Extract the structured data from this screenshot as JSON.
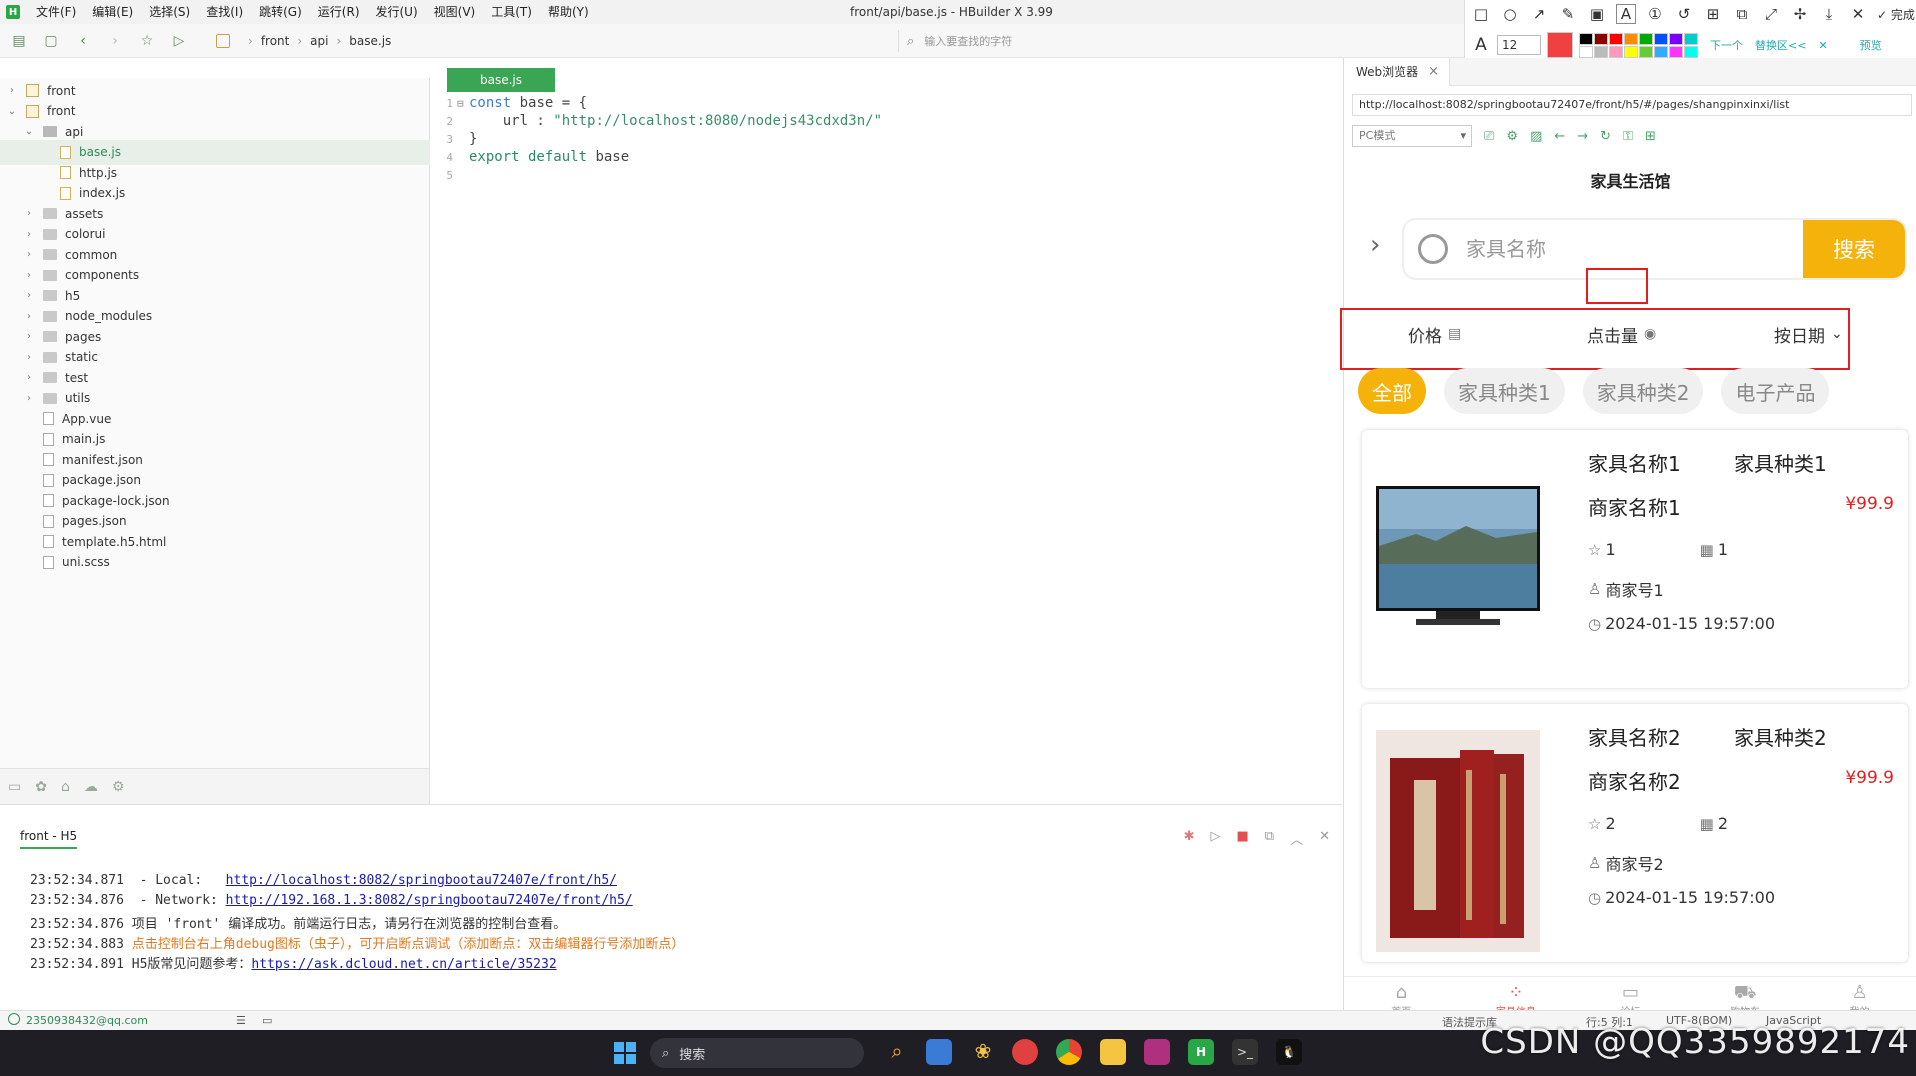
{
  "window": {
    "title": "front/api/base.js - HBuilder X 3.99",
    "menu": [
      "文件(F)",
      "编辑(E)",
      "选择(S)",
      "查找(I)",
      "跳转(G)",
      "运行(R)",
      "发行(U)",
      "视图(V)",
      "工具(T)",
      "帮助(Y)"
    ]
  },
  "screenshot_tool": {
    "done_label": "完成",
    "font_size": "12",
    "link_next": "下一个",
    "link_replace": "替换区<<",
    "preview_label": "预览",
    "palette": [
      "#000000",
      "#8b0000",
      "#ff0000",
      "#ff8c00",
      "#00aa00",
      "#0050ff",
      "#7a00ff",
      "#00cccc",
      "#ffffff",
      "#bbbbbb",
      "#ff99bb",
      "#ffff00",
      "#66cc33",
      "#33aaff",
      "#ff33ff",
      "#00ffee"
    ],
    "active_color": "#f04040"
  },
  "toolbar": {
    "breadcrumbs": [
      "front",
      "api",
      "base.js"
    ],
    "search_placeholder": "输入要查找的字符"
  },
  "filetree": {
    "items": [
      {
        "label": "front",
        "depth": 0,
        "type": "project",
        "open": false
      },
      {
        "label": "front",
        "depth": 0,
        "type": "project",
        "open": true
      },
      {
        "label": "api",
        "depth": 1,
        "type": "folder",
        "open": true
      },
      {
        "label": "base.js",
        "depth": 2,
        "type": "js",
        "selected": true
      },
      {
        "label": "http.js",
        "depth": 2,
        "type": "js"
      },
      {
        "label": "index.js",
        "depth": 2,
        "type": "js"
      },
      {
        "label": "assets",
        "depth": 1,
        "type": "folder"
      },
      {
        "label": "colorui",
        "depth": 1,
        "type": "folder"
      },
      {
        "label": "common",
        "depth": 1,
        "type": "folder"
      },
      {
        "label": "components",
        "depth": 1,
        "type": "folder"
      },
      {
        "label": "h5",
        "depth": 1,
        "type": "folder"
      },
      {
        "label": "node_modules",
        "depth": 1,
        "type": "folder"
      },
      {
        "label": "pages",
        "depth": 1,
        "type": "folder"
      },
      {
        "label": "static",
        "depth": 1,
        "type": "folder"
      },
      {
        "label": "test",
        "depth": 1,
        "type": "folder"
      },
      {
        "label": "utils",
        "depth": 1,
        "type": "folder"
      },
      {
        "label": "App.vue",
        "depth": 1,
        "type": "file"
      },
      {
        "label": "main.js",
        "depth": 1,
        "type": "file"
      },
      {
        "label": "manifest.json",
        "depth": 1,
        "type": "file"
      },
      {
        "label": "package.json",
        "depth": 1,
        "type": "file"
      },
      {
        "label": "package-lock.json",
        "depth": 1,
        "type": "file"
      },
      {
        "label": "pages.json",
        "depth": 1,
        "type": "file"
      },
      {
        "label": "template.h5.html",
        "depth": 1,
        "type": "file"
      },
      {
        "label": "uni.scss",
        "depth": 1,
        "type": "file"
      }
    ]
  },
  "editor": {
    "tab_label": "base.js",
    "lines": [
      {
        "n": "1",
        "parts": [
          [
            "kw",
            "const"
          ],
          [
            "plain",
            " base "
          ],
          [
            "plain",
            "= {"
          ]
        ]
      },
      {
        "n": "2",
        "parts": [
          [
            "plain",
            "    url : "
          ],
          [
            "str",
            "\"http://localhost:8080/nodejs43cdxd3n/\""
          ]
        ]
      },
      {
        "n": "3",
        "parts": [
          [
            "plain",
            "}"
          ]
        ]
      },
      {
        "n": "4",
        "parts": [
          [
            "kw2",
            "export default"
          ],
          [
            "plain",
            " base"
          ]
        ]
      },
      {
        "n": "5",
        "parts": []
      }
    ]
  },
  "browser": {
    "tab_label": "Web浏览器",
    "url": "http://localhost:8082/springbootau72407e/front/h5/#/pages/shangpinxinxi/list",
    "mode": "PC模式",
    "app": {
      "title": "家具生活馆",
      "search_placeholder": "家具名称",
      "search_button": "搜索",
      "sort": {
        "price": "价格",
        "clicks": "点击量",
        "date": "按日期"
      },
      "categories": [
        "全部",
        "家具种类1",
        "家具种类2",
        "电子产品"
      ],
      "products": [
        {
          "name": "家具名称1",
          "category": "家具种类1",
          "merchant": "商家名称1",
          "price": "¥99.9",
          "stars": "1",
          "count": "1",
          "shop": "商家号1",
          "time": "2024-01-15 19:57:00",
          "image": "monitor"
        },
        {
          "name": "家具名称2",
          "category": "家具种类2",
          "merchant": "商家名称2",
          "price": "¥99.9",
          "stars": "2",
          "count": "2",
          "shop": "商家号2",
          "time": "2024-01-15 19:57:00",
          "image": "books"
        }
      ],
      "tabbar": [
        {
          "label": "首页",
          "icon": "home-icon",
          "active": false
        },
        {
          "label": "家具信息",
          "icon": "grid-icon",
          "active": true
        },
        {
          "label": "论坛",
          "icon": "chat-icon",
          "active": false
        },
        {
          "label": "购物车",
          "icon": "cart-icon",
          "active": false
        },
        {
          "label": "我的",
          "icon": "user-icon",
          "active": false
        }
      ]
    }
  },
  "console": {
    "tab_label": "front - H5",
    "lines": [
      {
        "time": "23:52:34.871",
        "text": "  - Local:   ",
        "link": "http://localhost:8082/springbootau72407e/front/h5/"
      },
      {
        "time": "23:52:34.876",
        "text": "  - Network: ",
        "link": "http://192.168.1.3:8082/springbootau72407e/front/h5/"
      },
      {
        "time": "23:52:34.876",
        "text": " 项目 'front' 编译成功。前端运行日志，请另行在浏览器的控制台查看。"
      },
      {
        "time": "23:52:34.883",
        "warn": " 点击控制台右上角debug图标（虫子），可开启断点调试（添加断点：双击编辑器行号添加断点）"
      },
      {
        "time": "23:52:34.891",
        "text": " H5版常见问题参考：",
        "link": "https://ask.dcloud.net.cn/article/35232"
      }
    ]
  },
  "statusbar": {
    "user": "2350938432@qq.com",
    "right_items": [
      "语法提示库",
      "行:5  列:1",
      "UTF-8(BOM)",
      "JavaScript"
    ]
  },
  "taskbar": {
    "search_label": "搜索"
  },
  "watermark": "CSDN @QQ3359892174"
}
